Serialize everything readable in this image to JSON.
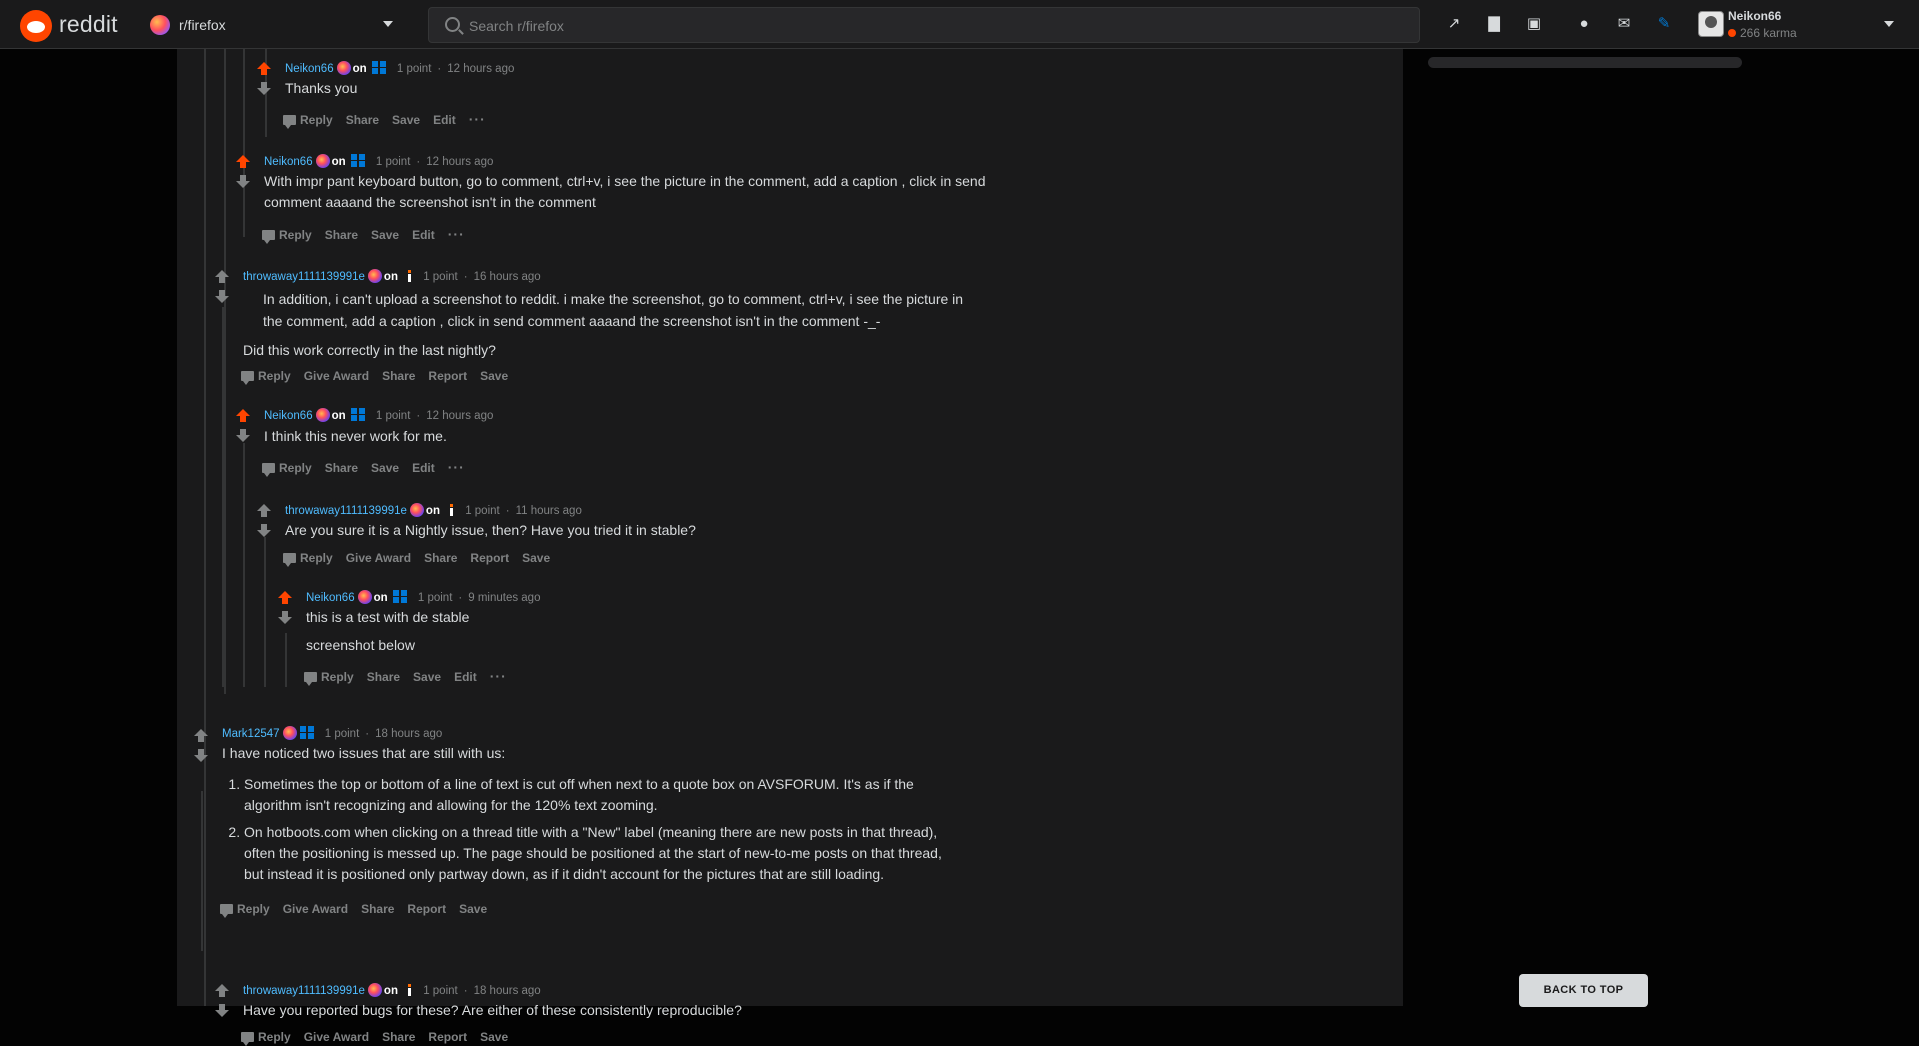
{
  "header": {
    "logo_text": "reddit",
    "subreddit": "r/firefox",
    "search_placeholder": "Search r/firefox",
    "user": {
      "name": "Neikon66",
      "karma": "266 karma"
    }
  },
  "actions_owner": {
    "reply": "Reply",
    "share": "Share",
    "save": "Save",
    "edit": "Edit",
    "more": "···"
  },
  "actions_other": {
    "reply": "Reply",
    "award": "Give Award",
    "share": "Share",
    "report": "Report",
    "save": "Save"
  },
  "labels": {
    "on": "on",
    "sep": "·"
  },
  "comments": [
    {
      "author": "Neikon66",
      "points": "1 point",
      "time": "12 hours ago",
      "body": [
        "Thanks you"
      ]
    },
    {
      "author": "Neikon66",
      "points": "1 point",
      "time": "12 hours ago",
      "body": [
        "With impr pant keyboard button, go to comment, ctrl+v, i see the picture in the comment, add a caption , click in send",
        "comment aaaand the screenshot isn't in the comment"
      ]
    },
    {
      "author": "throwaway1111139991e",
      "points": "1 point",
      "time": "16 hours ago",
      "quote": [
        "In addition, i can't upload a screenshot to reddit. i make the screenshot, go to comment, ctrl+v, i see the picture in",
        "the comment, add a caption , click in send comment aaaand the screenshot isn't in the comment -_-"
      ],
      "body": [
        "Did this work correctly in the last nightly?"
      ]
    },
    {
      "author": "Neikon66",
      "points": "1 point",
      "time": "12 hours ago",
      "body": [
        "I think this never work for me."
      ]
    },
    {
      "author": "throwaway1111139991e",
      "points": "1 point",
      "time": "11 hours ago",
      "body": [
        "Are you sure it is a Nightly issue, then? Have you tried it in stable?"
      ]
    },
    {
      "author": "Neikon66",
      "points": "1 point",
      "time": "9 minutes ago",
      "body": [
        "this is a test with de stable",
        "screenshot below"
      ]
    },
    {
      "author": "Mark12547",
      "points": "1 point",
      "time": "18 hours ago",
      "body": [
        "I have noticed two issues that are still with us:"
      ],
      "list": [
        [
          "Sometimes the top or bottom of a line of text is cut off when next to a quote box on AVSFORUM. It's as if the",
          "algorithm isn't recognizing and allowing for the 120% text zooming."
        ],
        [
          "On hotboots.com when clicking on a thread title with a \"New\" label (meaning there are new posts in that thread),",
          "often the positioning is messed up. The page should be positioned at the start of new-to-me posts on that thread,",
          "but instead it is positioned only partway down, as if it didn't account for the pictures that are still loading."
        ]
      ]
    },
    {
      "author": "throwaway1111139991e",
      "points": "1 point",
      "time": "18 hours ago",
      "body": [
        "Have you reported bugs for these? Are either of these consistently reproducible?"
      ]
    }
  ],
  "back_to_top": "BACK TO TOP",
  "colors": {
    "upvote": "#ff4500",
    "author": "#4fbcff",
    "background": "#1a1a1b",
    "page": "#030303"
  }
}
